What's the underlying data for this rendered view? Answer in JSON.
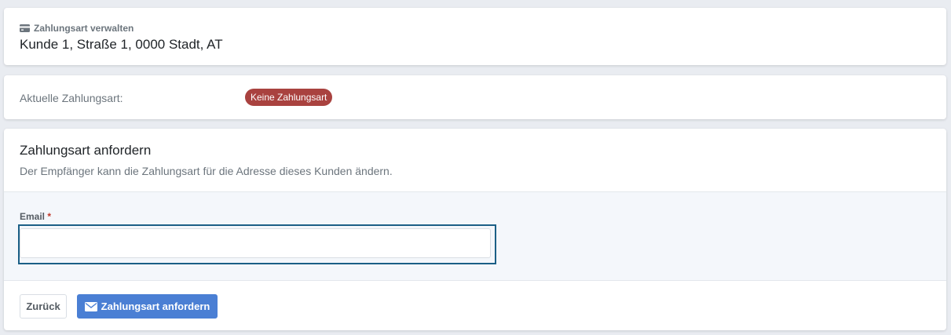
{
  "header": {
    "subtitle": "Zahlungsart verwalten",
    "title": "Kunde 1, Straße 1, 0000 Stadt, AT",
    "icon": "credit-card-icon"
  },
  "status": {
    "label": "Aktuelle Zahlungsart:",
    "badge": "Keine Zahlungsart",
    "badge_color": "#a9423f"
  },
  "request": {
    "title": "Zahlungsart anfordern",
    "description": "Der Empfänger kann die Zahlungsart für die Adresse dieses Kunden ändern.",
    "email_label": "Email",
    "required_marker": "*",
    "email_value": "",
    "email_placeholder": ""
  },
  "actions": {
    "back_label": "Zurück",
    "submit_label": "Zahlungsart anfordern",
    "submit_icon": "envelope-icon",
    "submit_color": "#4a7fd4"
  }
}
